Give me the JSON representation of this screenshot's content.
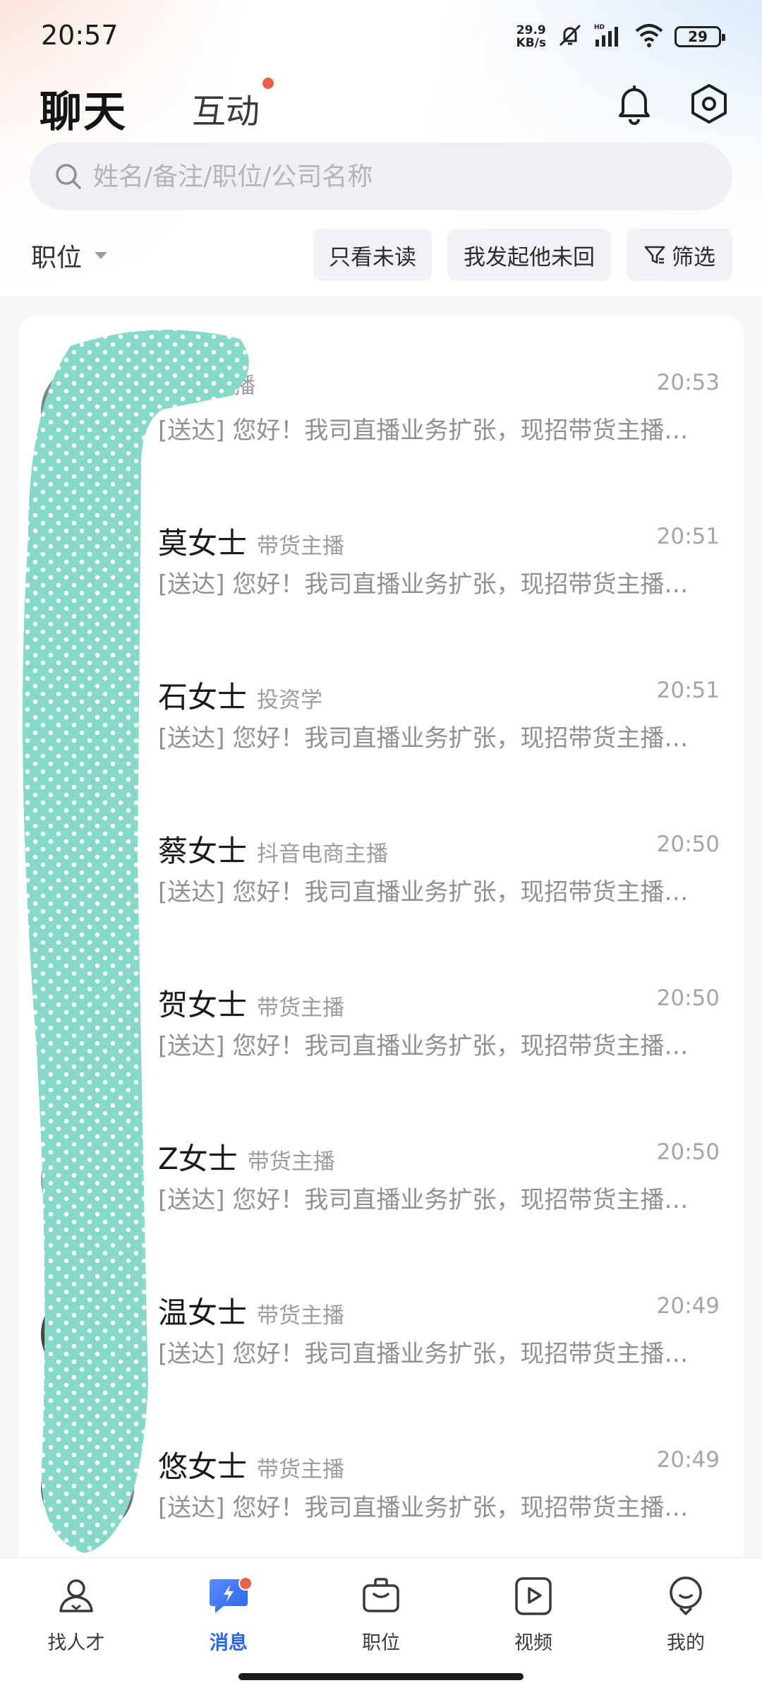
{
  "status_bar": {
    "time": "20:57",
    "net_speed_value": "29.9",
    "net_speed_unit": "KB/s",
    "battery": "29"
  },
  "header": {
    "tab_chat": "聊天",
    "tab_interact": "互动"
  },
  "search": {
    "placeholder": "姓名/备注/职位/公司名称"
  },
  "filters": {
    "position_label": "职位",
    "unread_only": "只看未读",
    "i_sent_no_reply": "我发起他未回",
    "filter": "筛选"
  },
  "chats": [
    {
      "name": "",
      "job": "带货主播",
      "time": "20:53",
      "preview": "[送达] 您好！我司直播业务扩张，现招带货主播，期待您的加入"
    },
    {
      "name": "莫女士",
      "job": "带货主播",
      "time": "20:51",
      "preview": "[送达] 您好！我司直播业务扩张，现招带货主播，期待您的加入"
    },
    {
      "name": "石女士",
      "job": "投资学",
      "time": "20:51",
      "preview": "[送达] 您好！我司直播业务扩张，现招带货主播，期待您的加入"
    },
    {
      "name": "蔡女士",
      "job": "抖音电商主播",
      "time": "20:50",
      "preview": "[送达] 您好！我司直播业务扩张，现招带货主播，期待您的加入"
    },
    {
      "name": "贺女士",
      "job": "带货主播",
      "time": "20:50",
      "preview": "[送达] 您好！我司直播业务扩张，现招带货主播，期待您的加入"
    },
    {
      "name": "Z女士",
      "job": "带货主播",
      "time": "20:50",
      "preview": "[送达] 您好！我司直播业务扩张，现招带货主播，期待您的加入"
    },
    {
      "name": "温女士",
      "job": "带货主播",
      "time": "20:49",
      "preview": "[送达] 您好！我司直播业务扩张，现招带货主播，期待您的加入"
    },
    {
      "name": "悠女士",
      "job": "带货主播",
      "time": "20:49",
      "preview": "[送达] 您好！我司直播业务扩张，现招带货主播，期待您的加入"
    }
  ],
  "bottom_nav": {
    "find_talent": "找人才",
    "messages": "消息",
    "positions": "职位",
    "videos": "视频",
    "mine": "我的"
  },
  "colors": {
    "accent": "#2b64e8",
    "badge": "#e8604c",
    "redaction": "#86d8c8"
  }
}
